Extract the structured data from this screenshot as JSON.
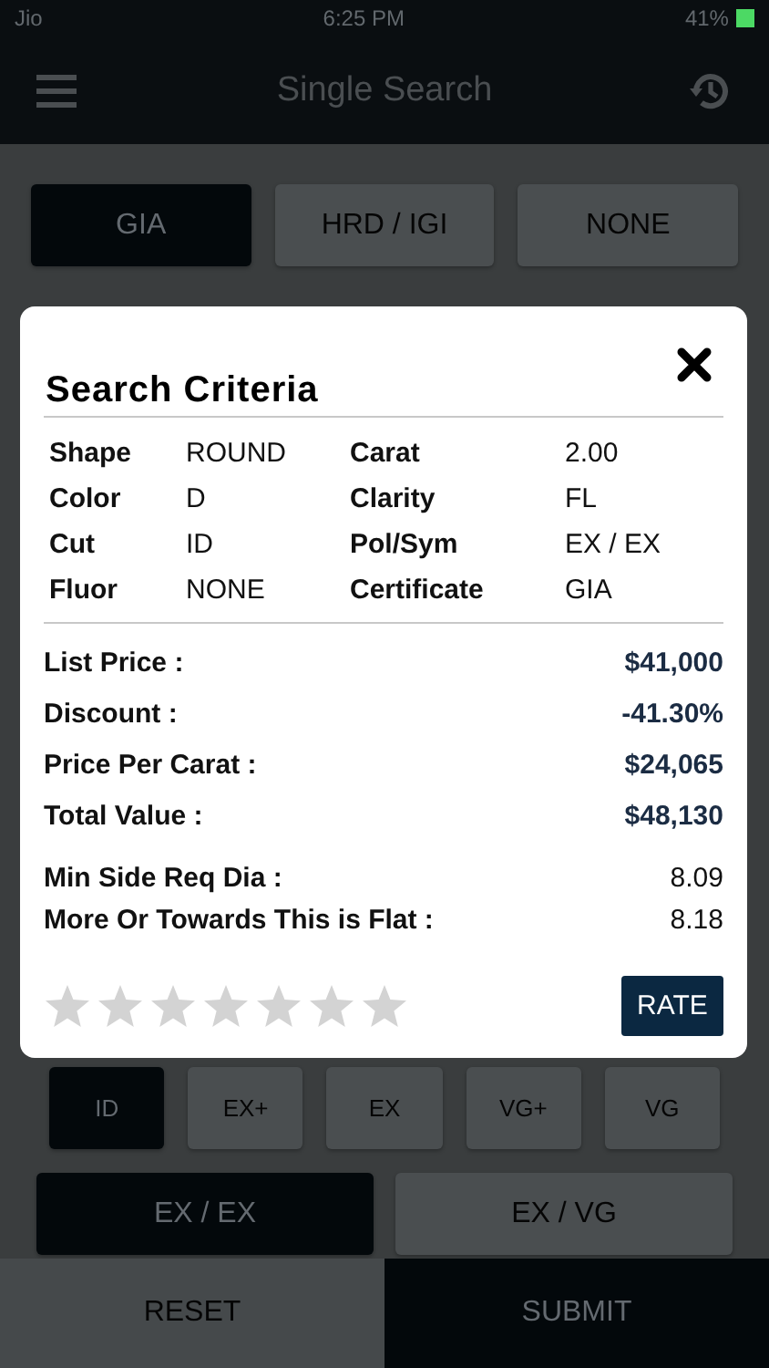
{
  "status_bar": {
    "carrier": "Jio",
    "time": "6:25 PM",
    "battery": "41%"
  },
  "header": {
    "title": "Single Search"
  },
  "certificate_options": [
    {
      "label": "GIA",
      "selected": true
    },
    {
      "label": "HRD / IGI",
      "selected": false
    },
    {
      "label": "NONE",
      "selected": false
    }
  ],
  "cut_options": [
    {
      "label": "ID",
      "selected": true
    },
    {
      "label": "EX+",
      "selected": false
    },
    {
      "label": "EX",
      "selected": false
    },
    {
      "label": "VG+",
      "selected": false
    },
    {
      "label": "VG",
      "selected": false
    }
  ],
  "polish_symmetry_options": [
    {
      "label": "EX / EX",
      "selected": true
    },
    {
      "label": "EX / VG",
      "selected": false
    }
  ],
  "dialog": {
    "title": "Search Criteria",
    "criteria": [
      {
        "label": "Shape",
        "value": "ROUND"
      },
      {
        "label": "Carat",
        "value": "2.00"
      },
      {
        "label": "Color",
        "value": "D"
      },
      {
        "label": "Clarity",
        "value": "FL"
      },
      {
        "label": "Cut",
        "value": "ID"
      },
      {
        "label": "Pol/Sym",
        "value": "EX / EX"
      },
      {
        "label": "Fluor",
        "value": "NONE"
      },
      {
        "label": "Certificate",
        "value": "GIA"
      }
    ],
    "prices": [
      {
        "label": "List Price :",
        "value": "$41,000"
      },
      {
        "label": "Discount :",
        "value": "-41.30%"
      },
      {
        "label": "Price Per Carat :",
        "value": "$24,065"
      },
      {
        "label": "Total Value :",
        "value": "$48,130"
      }
    ],
    "measurements": [
      {
        "label": "Min Side Req Dia :",
        "value": "8.09"
      },
      {
        "label": "More Or Towards This is Flat :",
        "value": "8.18"
      }
    ],
    "stars": 0,
    "rate_button": "RATE"
  },
  "bottom_bar": {
    "reset": "RESET",
    "submit": "SUBMIT"
  }
}
